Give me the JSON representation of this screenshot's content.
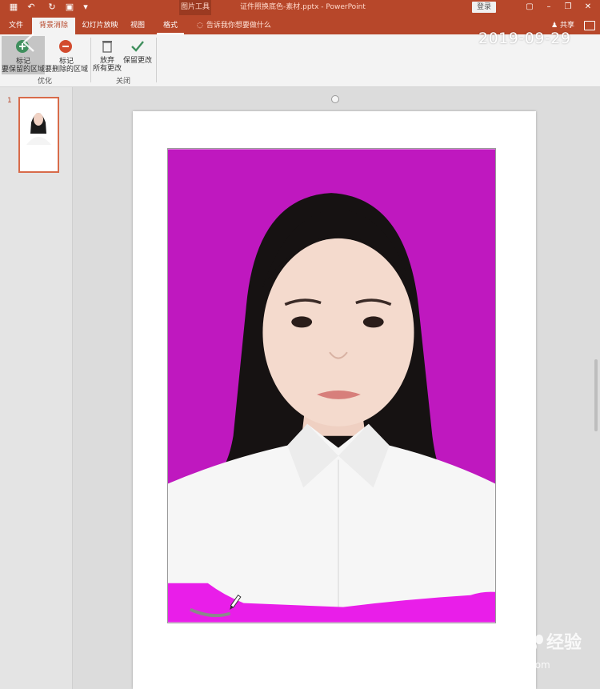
{
  "window": {
    "title": "证件照换底色-素材.pptx  -  PowerPoint",
    "tool_context": "图片工具",
    "signin_label": "登录",
    "share_label": "共享"
  },
  "tabs": [
    {
      "label": "文件",
      "active": false
    },
    {
      "label": "背景消除",
      "active": true
    },
    {
      "label": "幻灯片放映",
      "active": false
    },
    {
      "label": "视图",
      "active": false
    },
    {
      "label": "格式",
      "active": false
    }
  ],
  "tell_me": "告诉我你想要做什么",
  "ribbon": {
    "mark_keep": {
      "line1": "标记",
      "line2": "要保留的区域"
    },
    "mark_remove": {
      "line1": "标记",
      "line2": "要删除的区域"
    },
    "discard": {
      "line1": "放弃",
      "line2": "所有更改"
    },
    "keep_changes": "保留更改",
    "group_refine": "优化",
    "group_close": "关闭"
  },
  "overlay": {
    "date_stamp": "2019-09-29"
  },
  "slides": {
    "current_number": "1"
  },
  "watermark": {
    "brand": "Bai",
    "brand2": "经验",
    "url": "jingyan.baidu.com"
  },
  "colors": {
    "accent": "#b7472a",
    "removed_area": "#bf18bf",
    "removed_highlight": "#e91ee9"
  }
}
